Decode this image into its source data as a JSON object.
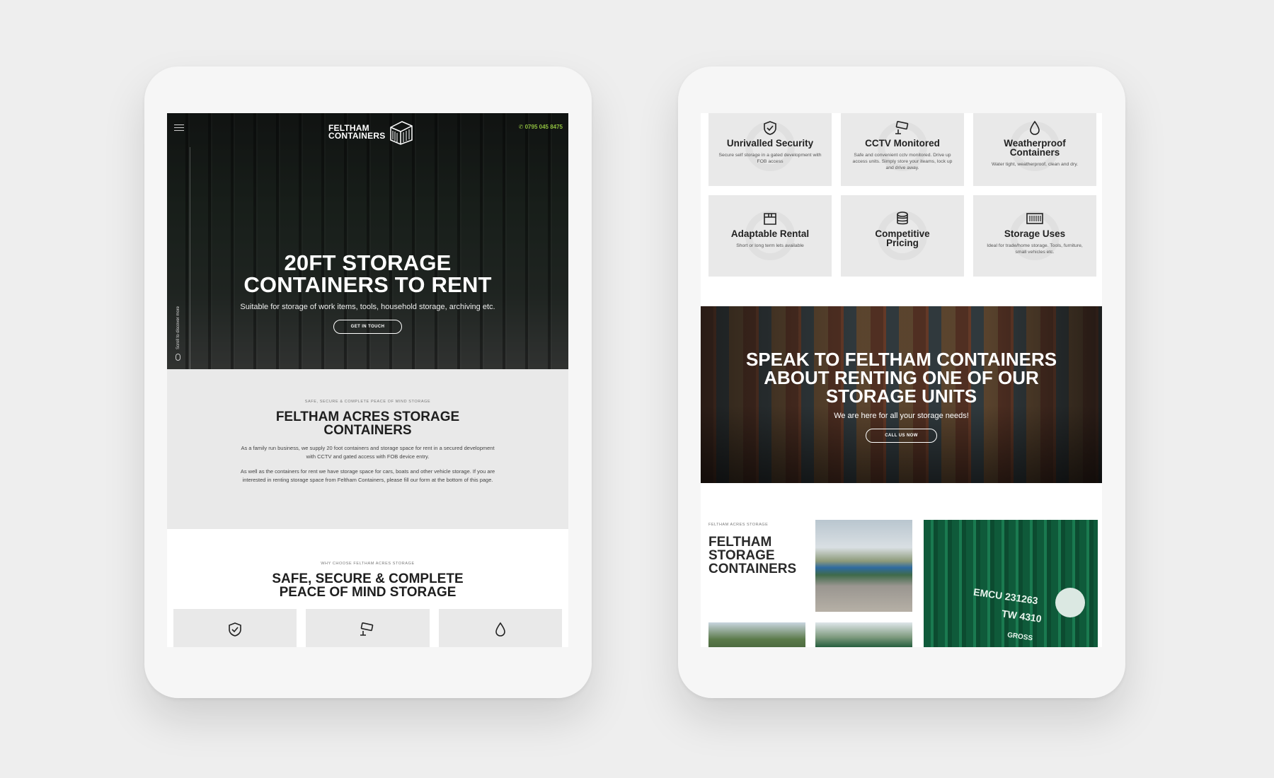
{
  "left_device": {
    "header": {
      "logo_line1": "FELTHAM",
      "logo_line2": "CONTAINERS",
      "phone": "0795 045 8475",
      "scroll_hint": "Scroll to discover more"
    },
    "hero": {
      "title_line1": "20FT STORAGE",
      "title_line2": "CONTAINERS TO RENT",
      "subtitle": "Suitable for storage of work items, tools, household storage, archiving etc.",
      "button": "GET IN TOUCH"
    },
    "intro": {
      "kicker": "SAFE, SECURE & COMPLETE PEACE OF MIND STORAGE",
      "title_line1": "FELTHAM ACRES STORAGE",
      "title_line2": "CONTAINERS",
      "para1": "As a family run business, we supply 20 foot containers and storage space for rent in a secured development with CCTV and gated access with FOB device entry.",
      "para2": "As well as the containers for rent we have storage space for cars, boats and other vehicle storage. If you are interested in renting storage space from Feltham Containers, please fill our form at the bottom of this page."
    },
    "why": {
      "kicker": "WHY CHOOSE FELTHAM ACRES STORAGE",
      "title_line1": "SAFE, SECURE & COMPLETE",
      "title_line2": "PEACE OF MIND STORAGE"
    }
  },
  "right_device": {
    "features": [
      {
        "title": "Unrivalled Security",
        "text": "Secure self storage in a gated development with FOB access",
        "icon": "shield-check-icon"
      },
      {
        "title": "CCTV Monitored",
        "text": "Safe and convenient cctv monitored. Drive up access units. Simply store your iteams, lock up and drive away.",
        "icon": "cctv-camera-icon"
      },
      {
        "title": "Weatherproof Containers",
        "text": "Water tight, weatherproof, clean and dry.",
        "icon": "water-drop-icon"
      },
      {
        "title": "Adaptable Rental",
        "text": "Short or long term lets available",
        "icon": "box-icon"
      },
      {
        "title": "Competitive Pricing",
        "text": "",
        "icon": "coins-icon"
      },
      {
        "title": "Storage Uses",
        "text": "Ideal for trade/home storage. Tools, furniture, small vehicles etc.",
        "icon": "container-icon"
      }
    ],
    "cta": {
      "title_line1": "SPEAK TO FELTHAM CONTAINERS",
      "title_line2": "ABOUT RENTING ONE OF OUR",
      "title_line3": "STORAGE UNITS",
      "subtitle": "We are here for all your storage needs!",
      "button": "CALL US NOW"
    },
    "gallery": {
      "kicker": "FELTHAM ACRES STORAGE",
      "title_line1": "FELTHAM",
      "title_line2": "STORAGE",
      "title_line3": "CONTAINERS",
      "photo_text1": "EMCU 231263",
      "photo_text2": "TW 4310",
      "photo_text3": "GROSS"
    }
  },
  "colors": {
    "background": "#eeeeee",
    "accent_green": "#8fbf3f",
    "panel_grey": "#e9e9e9",
    "heading": "#1e1e1e"
  }
}
